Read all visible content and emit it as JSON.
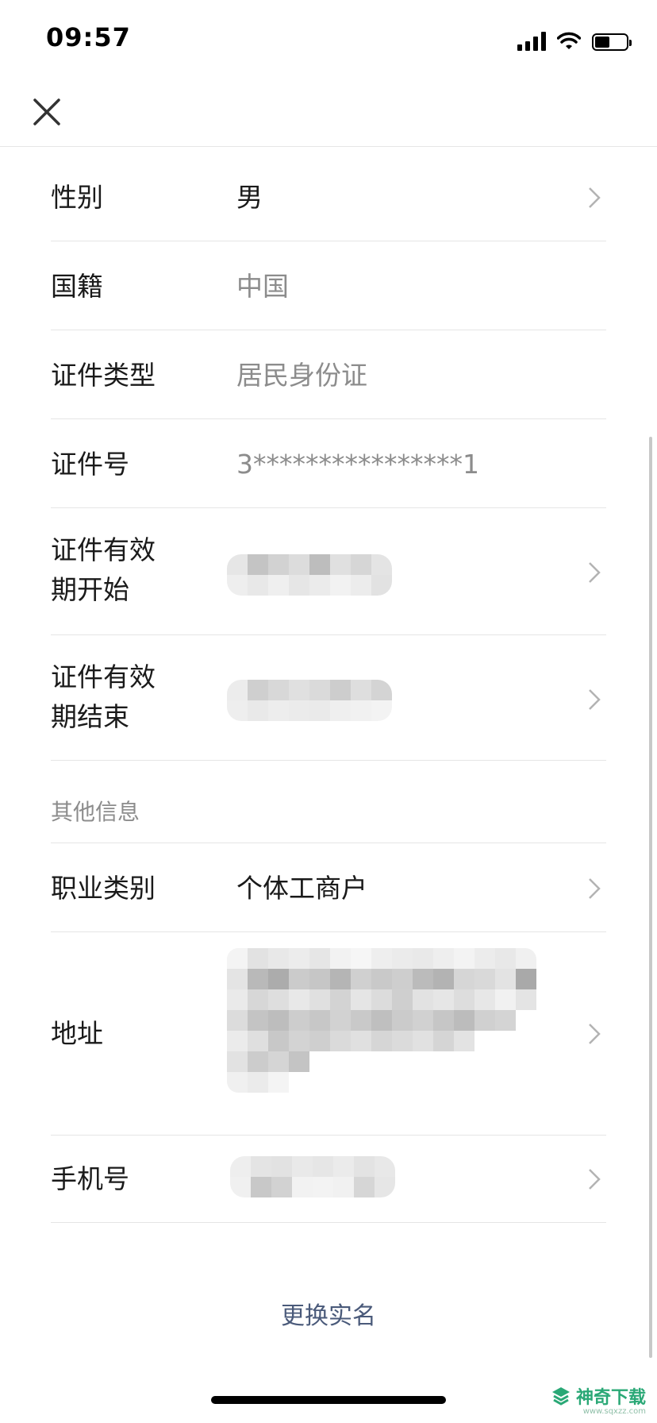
{
  "status_bar": {
    "time": "09:57",
    "icons": [
      "signal-icon",
      "wifi-icon",
      "battery-icon"
    ]
  },
  "nav": {
    "close_icon": "close-icon"
  },
  "rows": [
    {
      "label": "性别",
      "value": "男",
      "muted": false,
      "chevron": true
    },
    {
      "label": "国籍",
      "value": "中国",
      "muted": true,
      "chevron": false
    },
    {
      "label": "证件类型",
      "value": "居民身份证",
      "muted": true,
      "chevron": false
    },
    {
      "label": "证件号",
      "value": "3****************1",
      "muted": true,
      "chevron": false
    },
    {
      "label_line1": "证件有效",
      "label_line2": "期开始",
      "value": "",
      "redacted": true,
      "chevron": true
    },
    {
      "label_line1": "证件有效",
      "label_line2": "期结束",
      "value": "",
      "redacted": true,
      "chevron": true
    }
  ],
  "other_section": {
    "title": "其他信息",
    "rows": [
      {
        "label": "职业类别",
        "value": "个体工商户",
        "chevron": true
      },
      {
        "label": "地址",
        "value": "",
        "redacted": true,
        "chevron": true
      },
      {
        "label": "手机号",
        "value": "",
        "redacted": true,
        "chevron": true
      }
    ]
  },
  "footer": {
    "change_name_label": "更换实名"
  },
  "watermark": {
    "text": "神奇下载",
    "sub": "www.sqxzz.com"
  },
  "colors": {
    "text_primary": "#1a1a1a",
    "text_muted": "#8c8c8c",
    "link": "#4a5a7a",
    "divider": "#e5e5e5",
    "watermark": "#2aa876"
  }
}
